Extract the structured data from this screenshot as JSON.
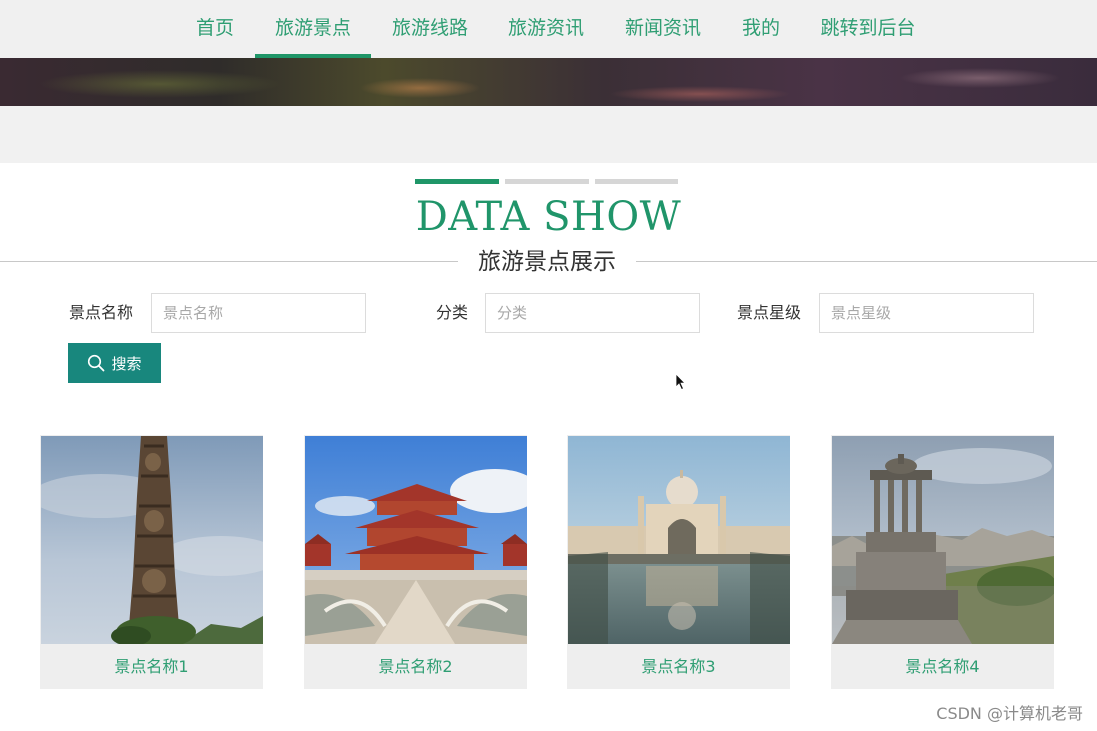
{
  "nav": {
    "items": [
      {
        "label": "首页"
      },
      {
        "label": "旅游景点",
        "active": true
      },
      {
        "label": "旅游线路"
      },
      {
        "label": "旅游资讯"
      },
      {
        "label": "新闻资讯"
      },
      {
        "label": "我的"
      },
      {
        "label": "跳转到后台"
      }
    ]
  },
  "heading": {
    "en": "DATA SHOW",
    "cn": "旅游景点展示"
  },
  "search": {
    "fields": [
      {
        "label": "景点名称",
        "placeholder": "景点名称",
        "value": ""
      },
      {
        "label": "分类",
        "placeholder": "分类",
        "value": ""
      },
      {
        "label": "景点星级",
        "placeholder": "景点星级",
        "value": ""
      }
    ],
    "button_label": "搜索"
  },
  "cards": [
    {
      "name": "景点名称1",
      "image": "carved totem pillar"
    },
    {
      "name": "景点名称2",
      "image": "chinese pagoda palace"
    },
    {
      "name": "景点名称3",
      "image": "domed palace with reflecting pool"
    },
    {
      "name": "景点名称4",
      "image": "round colonnade monument over city"
    }
  ],
  "colors": {
    "accent": "#1f9668",
    "link": "#2f9e73",
    "button": "#18877d"
  },
  "watermark": "CSDN @计算机老哥"
}
